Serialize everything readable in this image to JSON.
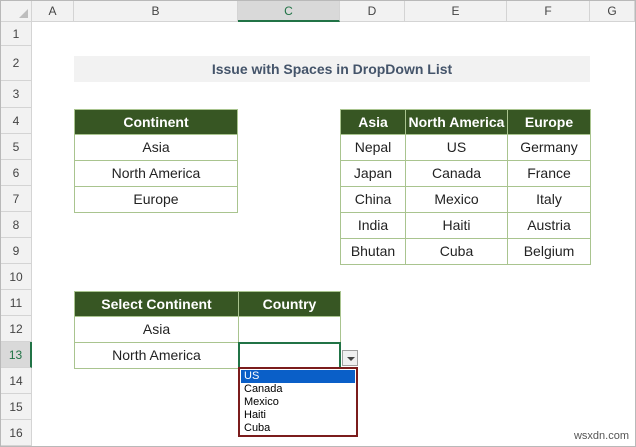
{
  "columns": [
    "A",
    "B",
    "C",
    "D",
    "E",
    "F",
    "G"
  ],
  "selected_column": "C",
  "rows": [
    "1",
    "2",
    "3",
    "4",
    "5",
    "6",
    "7",
    "8",
    "9",
    "10",
    "11",
    "12",
    "13",
    "14",
    "15",
    "16"
  ],
  "selected_row": "13",
  "title": "Issue with Spaces in DropDown List",
  "continent_table": {
    "header": "Continent",
    "items": [
      "Asia",
      "North America",
      "Europe"
    ]
  },
  "country_table": {
    "headers": [
      "Asia",
      "North America",
      "Europe"
    ],
    "rows": [
      [
        "Nepal",
        "US",
        "Germany"
      ],
      [
        "Japan",
        "Canada",
        "France"
      ],
      [
        "China",
        "Mexico",
        "Italy"
      ],
      [
        "India",
        "Haiti",
        "Austria"
      ],
      [
        "Bhutan",
        "Cuba",
        "Belgium"
      ]
    ]
  },
  "select_table": {
    "headers": [
      "Select Continent",
      "Country"
    ],
    "rows": [
      [
        "Asia",
        ""
      ],
      [
        "North America",
        ""
      ]
    ]
  },
  "dropdown": {
    "options": [
      "US",
      "Canada",
      "Mexico",
      "Haiti",
      "Cuba"
    ],
    "highlighted": "US",
    "button_icon": "dropdown-arrow-icon"
  },
  "watermark": "wsxdn.com",
  "colors": {
    "header_green": "#375623",
    "border_green": "#a9c48f",
    "title_bg": "#f2f2f2",
    "title_text": "#44546a",
    "dropdown_border": "#7b1c1c",
    "highlight": "#0a5fc8"
  }
}
